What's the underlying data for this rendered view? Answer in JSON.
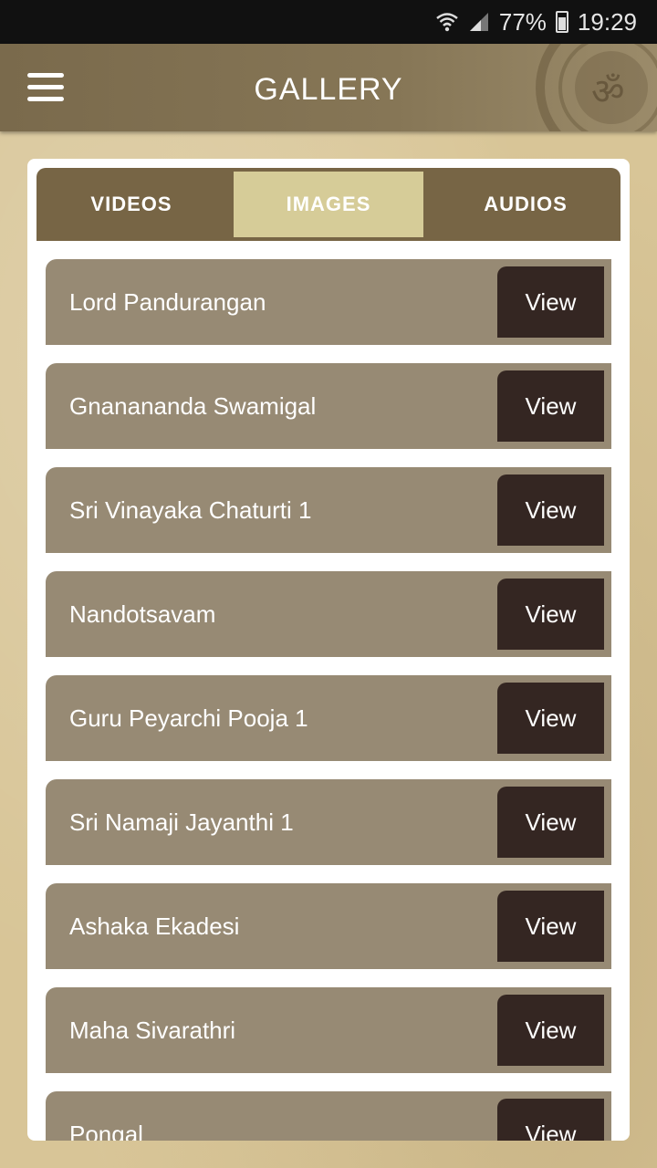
{
  "status_bar": {
    "battery_percent": "77%",
    "time": "19:29",
    "icons": [
      "wifi-icon",
      "signal-icon",
      "battery-icon"
    ]
  },
  "app_bar": {
    "title": "GALLERY",
    "menu_icon": "hamburger-menu-icon"
  },
  "tabs": [
    {
      "label": "VIDEOS",
      "active": false
    },
    {
      "label": "IMAGES",
      "active": true
    },
    {
      "label": "AUDIOS",
      "active": false
    }
  ],
  "items": [
    {
      "title": "Lord Pandurangan",
      "action": "View"
    },
    {
      "title": "Gnanananda Swamigal",
      "action": "View"
    },
    {
      "title": "Sri Vinayaka Chaturti 1",
      "action": "View"
    },
    {
      "title": "Nandotsavam",
      "action": "View"
    },
    {
      "title": "Guru Peyarchi Pooja 1",
      "action": "View"
    },
    {
      "title": "Sri Namaji Jayanthi 1",
      "action": "View"
    },
    {
      "title": "Ashaka Ekadesi",
      "action": "View"
    },
    {
      "title": "Maha Sivarathri",
      "action": "View"
    },
    {
      "title": "Pongal",
      "action": "View"
    }
  ],
  "colors": {
    "app_bar": "#7a6a4c",
    "tab_bar": "#776545",
    "tab_active": "#d6cc98",
    "item_bg": "#978a74",
    "view_button": "#342622"
  }
}
